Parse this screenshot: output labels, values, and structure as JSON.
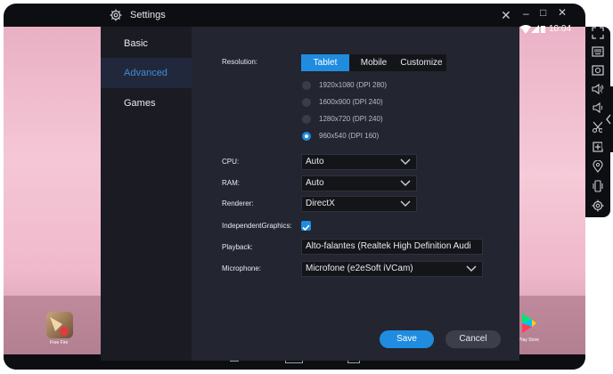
{
  "window": {
    "title": "Settings",
    "close_glyph": "✕",
    "minimize_glyph": "–",
    "maximize_glyph": "□"
  },
  "android": {
    "status_time": "10:04",
    "left_app_label": "Free Fire",
    "right_app_label": "Play Store"
  },
  "sidebar": {
    "items": [
      {
        "label": "Basic"
      },
      {
        "label": "Advanced",
        "active": true
      },
      {
        "label": "Games"
      }
    ]
  },
  "settings": {
    "resolution": {
      "label": "Resolution:",
      "tabs": [
        "Tablet",
        "Mobile",
        "Customize"
      ],
      "selected_tab": "Tablet",
      "options": [
        "1920x1080 (DPI 280)",
        "1600x900 (DPI 240)",
        "1280x720 (DPI 240)",
        "960x540 (DPI 160)"
      ],
      "selected_option": "960x540 (DPI 160)"
    },
    "cpu": {
      "label": "CPU:",
      "value": "Auto"
    },
    "ram": {
      "label": "RAM:",
      "value": "Auto"
    },
    "renderer": {
      "label": "Renderer:",
      "value": "DirectX"
    },
    "independent_graphics": {
      "label": "IndependentGraphics:",
      "checked": true
    },
    "playback": {
      "label": "Playback:",
      "value": "Alto-falantes (Realtek High Definition Audi"
    },
    "microphone": {
      "label": "Microphone:",
      "value": "Microfone (e2eSoft iVCam)"
    }
  },
  "buttons": {
    "save": "Save",
    "cancel": "Cancel"
  },
  "colors": {
    "accent": "#1f8ce0",
    "panel_bg": "#232530",
    "sidebar_bg": "#1b1c23",
    "active_sidebar_text": "#3b8fd6"
  },
  "toolbar_icons": [
    "fullscreen-icon",
    "keyboard-icon",
    "screenshot-icon",
    "volume-up-icon",
    "volume-down-icon",
    "scissors-icon",
    "apk-install-icon",
    "location-icon",
    "shake-icon",
    "settings-icon"
  ]
}
